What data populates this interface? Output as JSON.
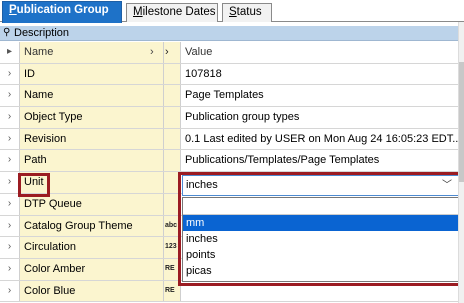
{
  "tabs": [
    {
      "label": "Publication Group",
      "active": true
    },
    {
      "label": "Milestone Dates",
      "active": false
    },
    {
      "label": "Status",
      "active": false
    }
  ],
  "description_label": "Description",
  "columns": {
    "name": "Name",
    "value": "Value"
  },
  "rows": [
    {
      "name": "ID",
      "type_badge": "",
      "value": "107818"
    },
    {
      "name": "Name",
      "type_badge": "",
      "value": "Page Templates"
    },
    {
      "name": "Object Type",
      "type_badge": "",
      "value": "Publication group types"
    },
    {
      "name": "Revision",
      "type_badge": "",
      "value": "0.1 Last edited by USER on Mon Aug 24 16:05:23 EDT..."
    },
    {
      "name": "Path",
      "type_badge": "",
      "value": "Publications/Templates/Page Templates"
    },
    {
      "name": "Unit",
      "type_badge": "",
      "value": ""
    },
    {
      "name": "DTP Queue",
      "type_badge": "",
      "value": ""
    },
    {
      "name": "Catalog Group Theme",
      "type_badge": "abc",
      "value": ""
    },
    {
      "name": "Circulation",
      "type_badge": "123",
      "value": ""
    },
    {
      "name": "Color Amber",
      "type_badge": "RE",
      "value": ""
    },
    {
      "name": "Color Blue",
      "type_badge": "RE",
      "value": ""
    }
  ],
  "unit_select": {
    "selected": "inches",
    "options": [
      "",
      "mm",
      "inches",
      "points",
      "picas"
    ],
    "highlighted": "mm"
  },
  "colors": {
    "tab_active": "#1e72c8",
    "name_col_bg": "#fbf5cf",
    "desc_bar": "#bcd3ea",
    "highlight_border": "#9b1c22",
    "option_selected": "#0a64d2"
  }
}
